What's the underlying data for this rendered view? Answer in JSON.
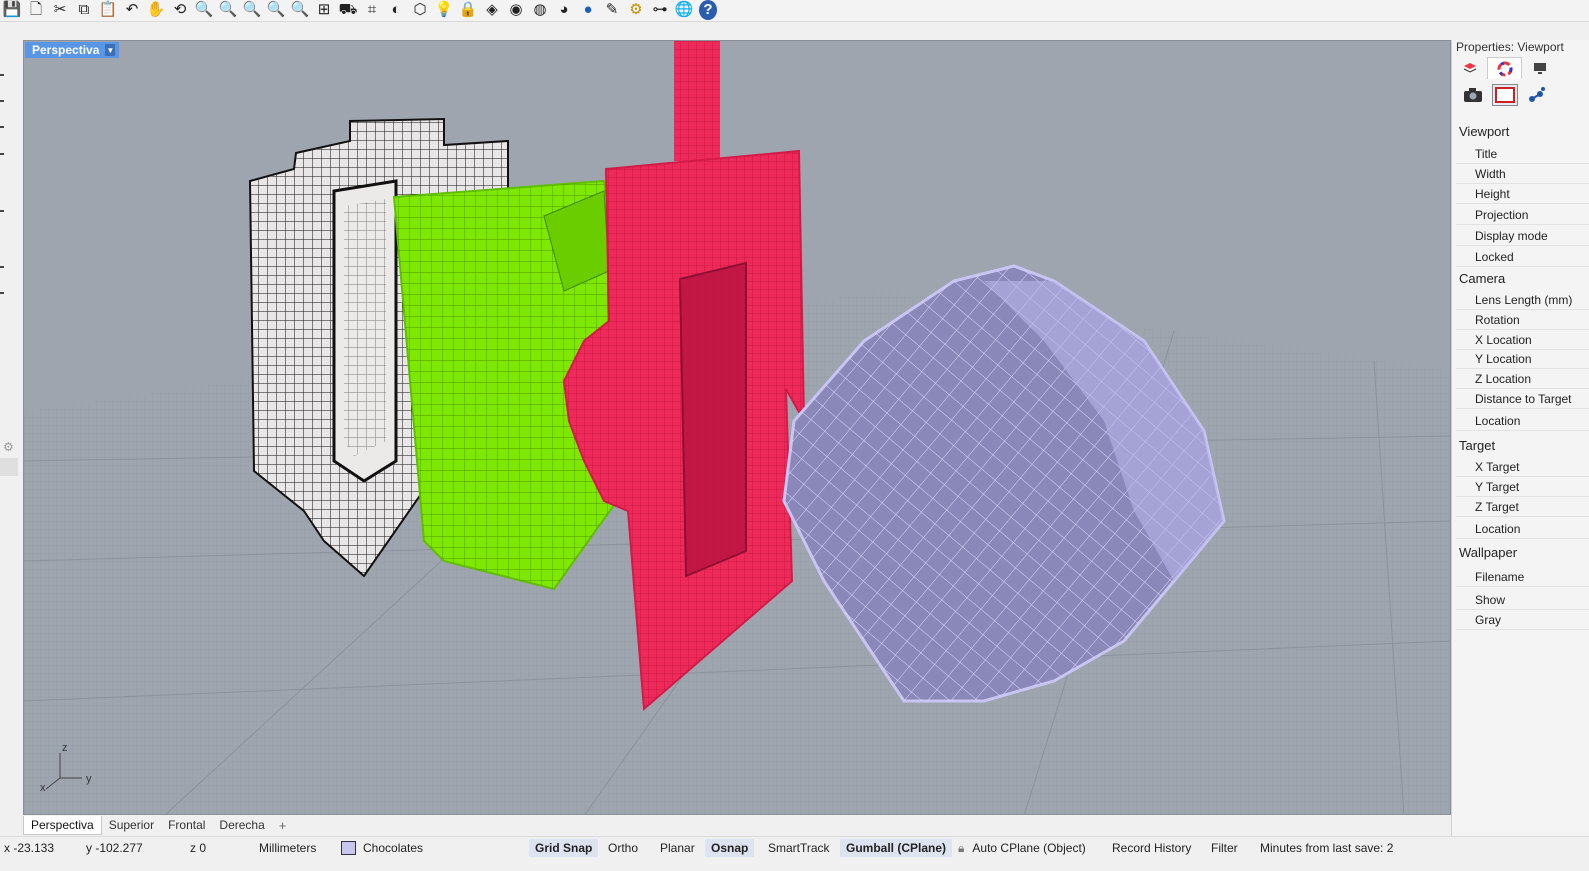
{
  "toolbar": {
    "icons": [
      "save-icon",
      "new-document-icon",
      "cut-icon",
      "copy-icon",
      "paste-icon",
      "undo-icon",
      "pan-icon",
      "rotate-view-icon",
      "zoom-icon",
      "zoom-window-icon",
      "zoom-extents-icon",
      "zoom-selected-icon",
      "zoom-all-icon",
      "four-viewports-icon",
      "cplane-icon",
      "set-view-icon",
      "display-mode-icon",
      "select-icon",
      "light-icon",
      "lock-icon",
      "layer-icon",
      "color-wheel-icon",
      "render-preview-icon",
      "shaded-icon",
      "render-icon",
      "pen-icon",
      "options-gear-icon",
      "join-icon",
      "globe-icon",
      "help-icon"
    ]
  },
  "viewport": {
    "title": "Perspectiva",
    "axis_labels": {
      "x": "x",
      "y": "y",
      "z": "z"
    }
  },
  "view_tabs": [
    "Perspectiva",
    "Superior",
    "Frontal",
    "Derecha"
  ],
  "view_tab_add": "+",
  "status": {
    "x": "x -23.133",
    "y": "y -102.277",
    "z": "z 0",
    "units": "Millimeters",
    "layer": "Chocolates",
    "layer_color": "#c9c6ee",
    "grid_snap": "Grid Snap",
    "ortho": "Ortho",
    "planar": "Planar",
    "osnap": "Osnap",
    "smarttrack": "SmartTrack",
    "gumball": "Gumball (CPlane)",
    "auto_cplane": "Auto CPlane (Object)",
    "record_history": "Record History",
    "filter": "Filter",
    "minutes_save": "Minutes from last save: 2"
  },
  "properties": {
    "title": "Properties: Viewport",
    "sections": {
      "viewport": {
        "label": "Viewport",
        "rows": [
          "Title",
          "Width",
          "Height",
          "Projection",
          "Display mode",
          "Locked"
        ]
      },
      "camera": {
        "label": "Camera",
        "rows": [
          "Lens Length (mm)",
          "Rotation",
          "X Location",
          "Y Location",
          "Z Location",
          "Distance to Target",
          "Location"
        ]
      },
      "target": {
        "label": "Target",
        "rows": [
          "X Target",
          "Y Target",
          "Z Target",
          "Location"
        ]
      },
      "wallpaper": {
        "label": "Wallpaper",
        "rows": [
          "Filename",
          "Show",
          "Gray"
        ]
      }
    }
  },
  "colors": {
    "viewport_bg": "#9ea5ae",
    "object_black": "#111111",
    "object_green": "#7fe800",
    "object_red": "#ee2a5a",
    "object_lavender": "#c8c5f5",
    "viewport_tab_bg": "#5a96e6"
  }
}
